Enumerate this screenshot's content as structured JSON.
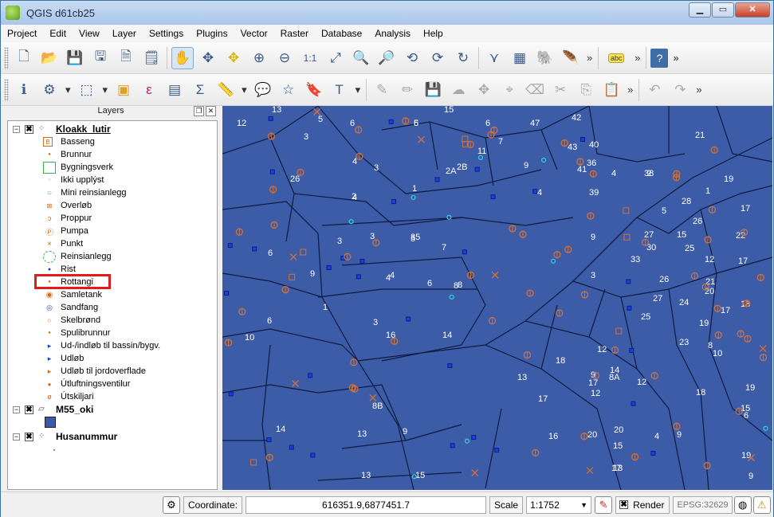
{
  "window": {
    "title": "QGIS d61cb25"
  },
  "menu": [
    "Project",
    "Edit",
    "View",
    "Layer",
    "Settings",
    "Plugins",
    "Vector",
    "Raster",
    "Database",
    "Analysis",
    "Help"
  ],
  "toolbar": {
    "overflow": "»",
    "abc_label": "abc"
  },
  "layers_panel": {
    "title": "Layers",
    "groups": [
      {
        "name": "Kloakk_lutir",
        "checked": "✖",
        "items": [
          {
            "label": "Basseng",
            "icon": "basseng-icon"
          },
          {
            "label": "Brunnur",
            "icon": "dot-icon"
          },
          {
            "label": "Bygningsverk",
            "icon": "green-square-icon"
          },
          {
            "label": "Ikki upplýst",
            "icon": "cyan-dot-icon"
          },
          {
            "label": "Mini reinsianlegg",
            "icon": "green-circle-icon"
          },
          {
            "label": "Overløb",
            "icon": "square-marker-icon"
          },
          {
            "label": "Proppur",
            "icon": "proppur-icon"
          },
          {
            "label": "Pumpa",
            "icon": "pumpa-icon"
          },
          {
            "label": "Punkt",
            "icon": "cross-icon"
          },
          {
            "label": "Reinsianlegg",
            "icon": "dashed-circle-icon"
          },
          {
            "label": "Rist",
            "icon": "blue-dot-icon"
          },
          {
            "label": "Rottangi",
            "icon": "dot-icon"
          },
          {
            "label": "Samletank",
            "icon": "target-icon"
          },
          {
            "label": "Sandfang",
            "icon": "blue-ring-icon"
          },
          {
            "label": "Skelbrønd",
            "icon": "orange-ring-icon"
          },
          {
            "label": "Spulibrunnur",
            "icon": "dot-icon"
          },
          {
            "label": "Ud-/indløb til bassin/bygv.",
            "icon": "blue-arrow-icon"
          },
          {
            "label": "Udløb",
            "icon": "blue-arrow-icon"
          },
          {
            "label": "Udløb til jordoverflade",
            "icon": "orange-arrow-icon"
          },
          {
            "label": "Útluftningsventilur",
            "icon": "orange-dot-icon"
          },
          {
            "label": "Útskiljari",
            "icon": "slash-icon"
          }
        ]
      },
      {
        "name": "M55_oki",
        "checked": "✖"
      },
      {
        "name": "Husanummur",
        "checked": "✖"
      }
    ]
  },
  "map": {
    "background_color": "#3c5ca8",
    "parcel_labels": [
      "13",
      "5",
      "6",
      "6",
      "15",
      "5",
      "6",
      "3",
      "47",
      "42",
      "21",
      "12",
      "3",
      "11",
      "7",
      "43",
      "40",
      "4",
      "26",
      "2A",
      "2B",
      "9",
      "41",
      "38",
      "19",
      "4",
      "1",
      "36",
      "4",
      "2",
      "4",
      "39",
      "28",
      "17",
      "1",
      "2",
      "5",
      "26",
      "3",
      "35",
      "9",
      "27",
      "15",
      "22",
      "3",
      "5",
      "7",
      "30",
      "25",
      "33",
      "12",
      "8",
      "3",
      "26",
      "21",
      "17",
      "6",
      "4",
      "6",
      "8",
      "27",
      "20",
      "24",
      "9",
      "18",
      "1",
      "4",
      "3",
      "25",
      "19",
      "17",
      "6",
      "14",
      "16",
      "23",
      "8",
      "10",
      "12",
      "8A",
      "18",
      "9",
      "12",
      "17",
      "14",
      "10",
      "19",
      "18",
      "13",
      "15",
      "17",
      "8B",
      "16",
      "12",
      "6",
      "14",
      "20",
      "20",
      "15",
      "9",
      "13",
      "9",
      "4",
      "19",
      "17",
      "13",
      "15",
      "13",
      "9"
    ]
  },
  "statusbar": {
    "coordinate_label": "Coordinate:",
    "coordinate_value": "616351.9,6877451.7",
    "scale_label": "Scale",
    "scale_value": "1:1752",
    "render_label": "Render",
    "render_checked": "✖",
    "crs": "EPSG:32629"
  }
}
